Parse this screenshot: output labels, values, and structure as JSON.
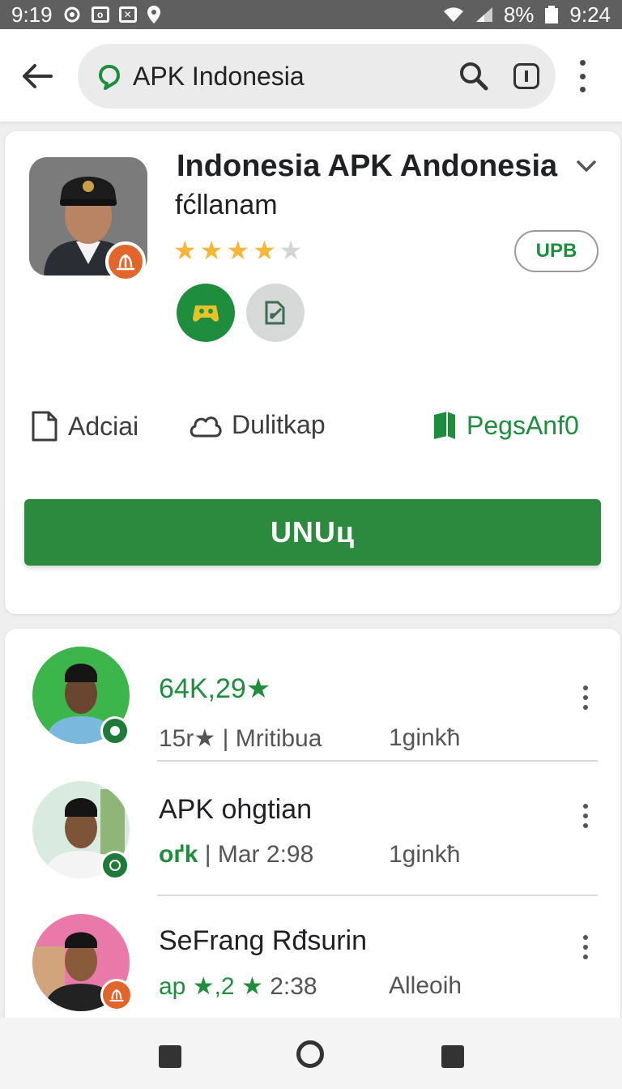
{
  "status_bar": {
    "left_time": "9:19",
    "battery": "8%",
    "time": "9:24"
  },
  "search": {
    "query": "APK Indonesia"
  },
  "app": {
    "title": "Indonesia APK Andonesia",
    "subtitle": "fćllanam",
    "rating_stars": 4,
    "rating_max": 5,
    "upb_label": "UPB",
    "actions": [
      {
        "label": "Adciai",
        "icon": "document-icon"
      },
      {
        "label": "Dulitkap",
        "icon": "cloud-icon"
      },
      {
        "label": "PegsAnf0",
        "icon": "book-icon"
      }
    ],
    "install_label": "UNUц"
  },
  "list": [
    {
      "title": "64K,29★",
      "meta": "15r★ | Mritibua",
      "right": "1ginkħ",
      "title_green": true
    },
    {
      "title": "APK ohgtian",
      "meta_green": "oґk",
      "meta": " | Mar 2:98",
      "right": "1ginkħ"
    },
    {
      "title": "SeFrang Rđsurin",
      "meta_green": "ap ★,2 ★",
      "meta": " 2:38",
      "right": "Alleoih"
    }
  ],
  "colors": {
    "accent": "#2b8a3e",
    "star": "#f5b63a",
    "badge": "#e2652b"
  }
}
